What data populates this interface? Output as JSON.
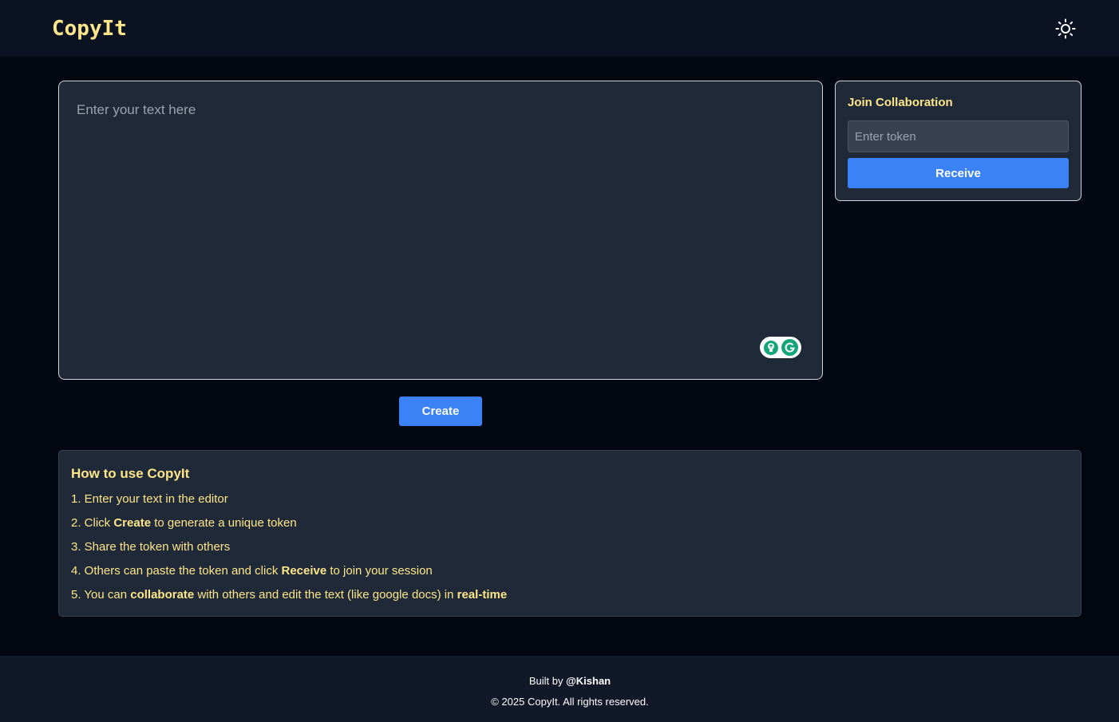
{
  "app": {
    "logo": "CopyIt",
    "theme_toggle_icon": "sun-icon"
  },
  "editor": {
    "placeholder": "Enter your text here",
    "value": "",
    "grammarly_icons": [
      "lightbulb-icon",
      "grammarly-icon"
    ]
  },
  "actions": {
    "create_label": "Create"
  },
  "join": {
    "title": "Join Collaboration",
    "token_placeholder": "Enter token",
    "token_value": "",
    "receive_label": "Receive"
  },
  "howto": {
    "title": "How to use CopyIt",
    "steps": [
      {
        "prefix": "1. Enter your text in the editor"
      },
      {
        "prefix": "2. Click ",
        "bold": "Create",
        "suffix": " to generate a unique token"
      },
      {
        "prefix": "3. Share the token with others"
      },
      {
        "prefix": "4. Others can paste the token and click ",
        "bold": "Receive",
        "suffix": " to join your session"
      },
      {
        "prefix": "5. You can ",
        "bold": "collaborate",
        "middle": " with others and edit the text (like google docs) in ",
        "bold2": "real-time"
      }
    ]
  },
  "footer": {
    "built_by_prefix": "Built by ",
    "author": "@Kishan",
    "copyright": "© 2025 CopyIt. All rights reserved."
  },
  "colors": {
    "background": "#030712",
    "header": "#0b1222",
    "panel": "#1f2937",
    "accent_yellow": "#fde68a",
    "button_blue": "#3b82f6"
  }
}
